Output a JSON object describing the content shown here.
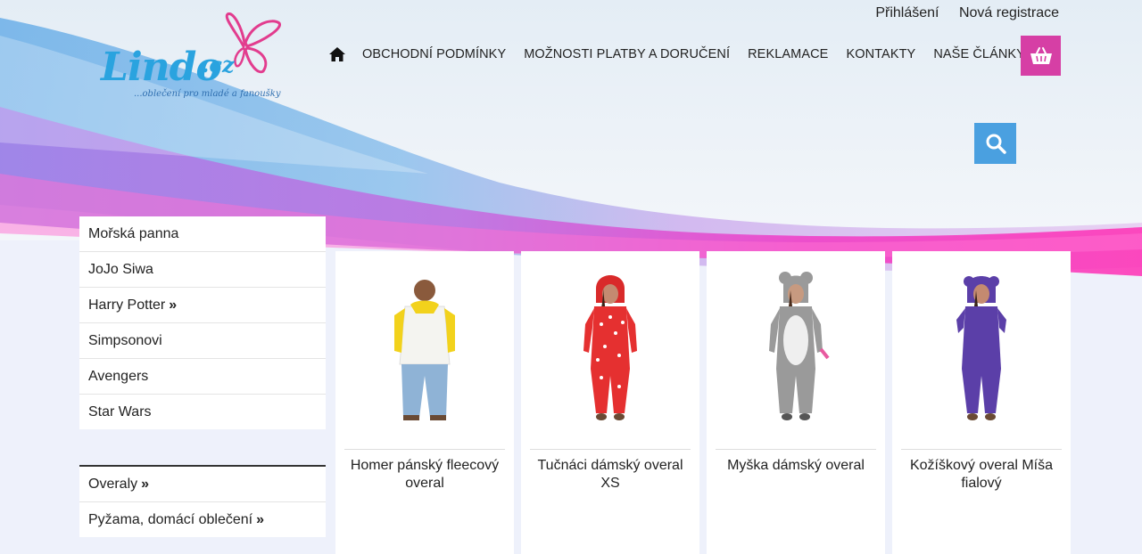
{
  "logo": {
    "name": "Lindo",
    "suffix": ".cz",
    "tagline": "...oblečení pro mladé a fanoušky"
  },
  "toplinks": {
    "login": "Přihlášení",
    "register": "Nová registrace"
  },
  "nav": {
    "home_icon": "home-icon",
    "items": [
      "OBCHODNÍ PODMÍNKY",
      "MOŽNOSTI PLATBY A DORUČENÍ",
      "REKLAMACE",
      "KONTAKTY",
      "NAŠE ČLÁNKY"
    ]
  },
  "cart": {
    "icon": "basket-icon",
    "color": "#d63fa5"
  },
  "search": {
    "icon": "search-icon",
    "color": "#4aa0e0"
  },
  "sidebar": {
    "group1": [
      {
        "label": "Mořská panna",
        "arrow": ""
      },
      {
        "label": "JoJo Siwa",
        "arrow": ""
      },
      {
        "label": "Harry Potter",
        "arrow": "»"
      },
      {
        "label": "Simpsonovi",
        "arrow": ""
      },
      {
        "label": "Avengers",
        "arrow": ""
      },
      {
        "label": "Star Wars",
        "arrow": ""
      }
    ],
    "group2": [
      {
        "label": "Overaly",
        "arrow": "»"
      },
      {
        "label": "Pyžama, domácí oblečení",
        "arrow": "»"
      }
    ]
  },
  "products": [
    {
      "title": "Homer pánský fleecový overal"
    },
    {
      "title": "Tučnáci dámský overal XS"
    },
    {
      "title": "Myška dámský overal"
    },
    {
      "title": "Kožíškový overal Míša fialový"
    }
  ]
}
